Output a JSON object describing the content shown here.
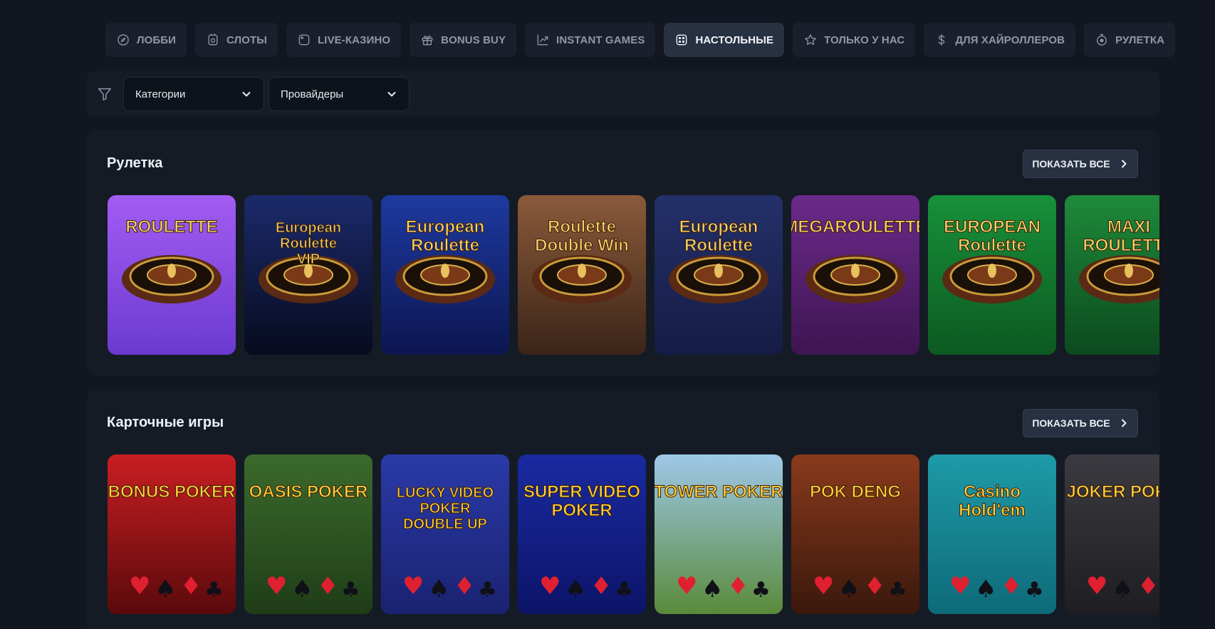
{
  "nav": [
    {
      "label": "ЛОББИ",
      "icon": "compass-icon"
    },
    {
      "label": "СЛОТЫ",
      "icon": "slot-icon"
    },
    {
      "label": "LIVE-КАЗИНО",
      "icon": "live-icon"
    },
    {
      "label": "BONUS BUY",
      "icon": "gift-icon"
    },
    {
      "label": "INSTANT GAMES",
      "icon": "chart-up-icon"
    },
    {
      "label": "НАСТОЛЬНЫЕ",
      "icon": "dice-icon",
      "active": true
    },
    {
      "label": "ТОЛЬКО У НАС",
      "icon": "star-icon"
    },
    {
      "label": "ДЛЯ ХАЙРОЛЛЕРОВ",
      "icon": "dollar-icon"
    },
    {
      "label": "РУЛЕТКА",
      "icon": "roulette-icon"
    }
  ],
  "filters": {
    "categories_label": "Категории",
    "providers_label": "Провайдеры"
  },
  "sections": [
    {
      "title": "Рулетка",
      "show_all": "ПОКАЗАТЬ ВСЕ",
      "games": [
        {
          "title": "ROULETTE",
          "bg1": "#a25cf2",
          "bg2": "#6c3ad0"
        },
        {
          "title": "European Roulette VIP",
          "bg1": "#1b2a6b",
          "bg2": "#070b1e"
        },
        {
          "title": "European Roulette",
          "bg1": "#1e3aa0",
          "bg2": "#0c1650"
        },
        {
          "title": "Roulette Double Win",
          "bg1": "#8a5a3a",
          "bg2": "#3b2418"
        },
        {
          "title": "European Roulette",
          "bg1": "#24306a",
          "bg2": "#151c44"
        },
        {
          "title": "MEGAROULETTE",
          "bg1": "#6b2a8a",
          "bg2": "#3e1552"
        },
        {
          "title": "EUROPEAN Roulette",
          "bg1": "#18903a",
          "bg2": "#0c5a22"
        },
        {
          "title": "MAXI ROULETTE",
          "bg1": "#1e8a3a",
          "bg2": "#0c4a1e"
        }
      ]
    },
    {
      "title": "Карточные игры",
      "show_all": "ПОКАЗАТЬ ВСЕ",
      "games": [
        {
          "title": "BONUS POKER",
          "bg1": "#c81e22",
          "bg2": "#5a0a0c"
        },
        {
          "title": "OASIS POKER",
          "bg1": "#3b6a2c",
          "bg2": "#1f3d18"
        },
        {
          "title": "LUCKY VIDEO POKER DOUBLE UP",
          "bg1": "#2a3aa8",
          "bg2": "#1a2270"
        },
        {
          "title": "SUPER VIDEO POKER",
          "bg1": "#1a2aa0",
          "bg2": "#0c1468"
        },
        {
          "title": "TOWER POKER",
          "bg1": "#9ec8e8",
          "bg2": "#5a8a3a"
        },
        {
          "title": "POK DENG",
          "bg1": "#8a3a1c",
          "bg2": "#3a180c"
        },
        {
          "title": "Casino Hold'em",
          "bg1": "#1e9aa8",
          "bg2": "#0e6a78"
        },
        {
          "title": "JOKER POKER",
          "bg1": "#3a3a40",
          "bg2": "#1e1e22"
        }
      ]
    }
  ]
}
